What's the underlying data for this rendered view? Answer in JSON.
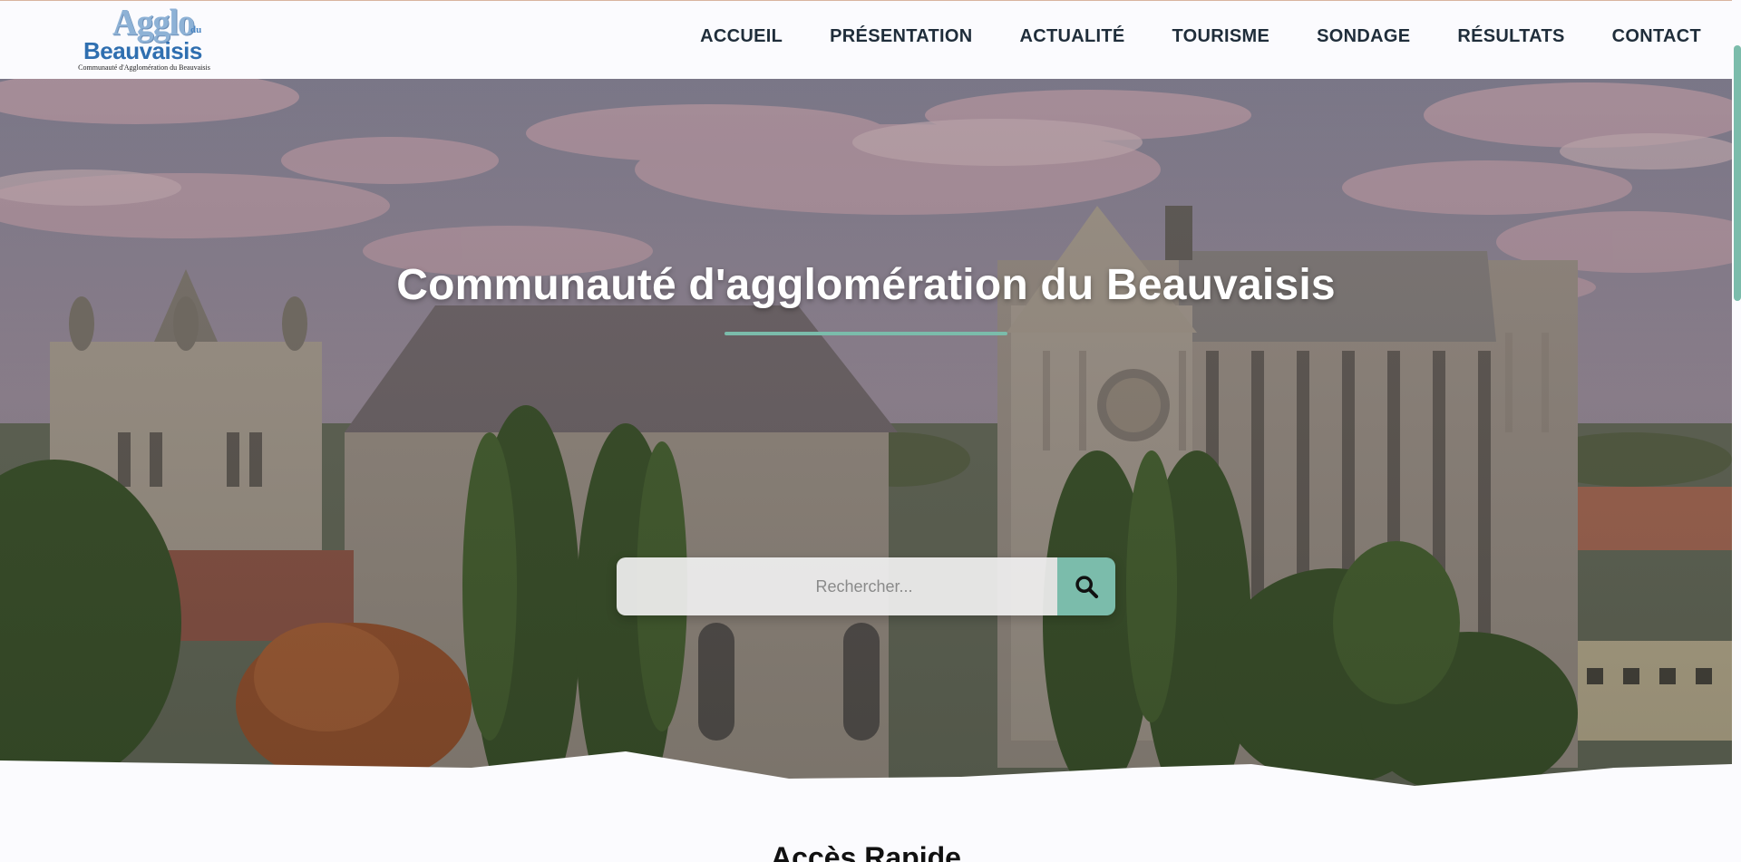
{
  "header": {
    "logo": {
      "line1": "Agglo",
      "line1_small": "du",
      "line2": "Beauvaisis",
      "subtitle": "Communauté d'Agglomération du Beauvaisis"
    },
    "nav": [
      {
        "label": "ACCUEIL"
      },
      {
        "label": "PRÉSENTATION"
      },
      {
        "label": "ACTUALITÉ"
      },
      {
        "label": "TOURISME"
      },
      {
        "label": "SONDAGE"
      },
      {
        "label": "RÉSULTATS"
      },
      {
        "label": "CONTACT"
      }
    ]
  },
  "hero": {
    "title": "Communauté d'agglomération du Beauvaisis",
    "search": {
      "placeholder": "Rechercher...",
      "value": "",
      "button_icon": "search-icon"
    }
  },
  "quick_access": {
    "title": "Accès Rapide"
  },
  "colors": {
    "accent": "#7bbcab",
    "nav_text": "#1f2d3a",
    "logo_blue": "#2f6fb0",
    "background": "#fbfbfe"
  }
}
